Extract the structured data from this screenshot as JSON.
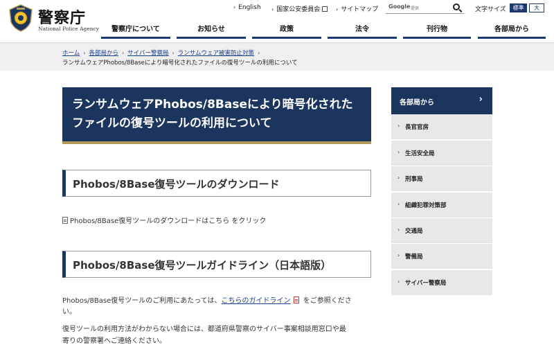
{
  "header": {
    "site_name": "警察庁",
    "site_sub": "National Police Agency",
    "utility_links": [
      "English",
      "国家公安委員会",
      "サイトマップ"
    ],
    "search": {
      "brand": "Google",
      "hint": "提供"
    },
    "font_size": {
      "label": "文字サイズ",
      "standard": "標準",
      "large": "大"
    },
    "nav": [
      "警察庁について",
      "お知らせ",
      "政策",
      "法令",
      "刊行物",
      "各部局から"
    ]
  },
  "breadcrumb": {
    "items": [
      "ホーム",
      "各部局から",
      "サイバー警察局",
      "ランサムウェア被害防止対策"
    ],
    "current": "ランサムウェアPhobos/8Baseにより暗号化されたファイルの復号ツールの利用について"
  },
  "main": {
    "title": "ランサムウェアPhobos/8Baseにより暗号化されたファイルの復号ツールの利用について",
    "section1": {
      "heading": "Phobos/8Base復号ツールのダウンロード",
      "text": "Phobos/8Base復号ツールのダウンロードはこちら をクリック"
    },
    "section2": {
      "heading": "Phobos/8Base復号ツールガイドライン（日本語版）",
      "para1_pre": "Phobos/8Base復号ツールのご利用にあたっては、",
      "para1_link": "こちらのガイドライン",
      "para1_post": " をご参照くださ",
      "para1_cont": "い。",
      "para2_line1": "復号ツールの利用方法がわからない場合には、都道府県警察のサイバー事案相談用窓口や最",
      "para2_line2": "寄りの警察署へご連絡ください。"
    }
  },
  "sidebar": {
    "title": "各部局から",
    "items": [
      "長官官房",
      "生活安全局",
      "刑事局",
      "組織犯罪対策部",
      "交通局",
      "警備局",
      "サイバー警察局"
    ]
  },
  "colors": {
    "navy": "#1c355e",
    "gold": "#b49a5b",
    "link": "#1a3f8c"
  }
}
